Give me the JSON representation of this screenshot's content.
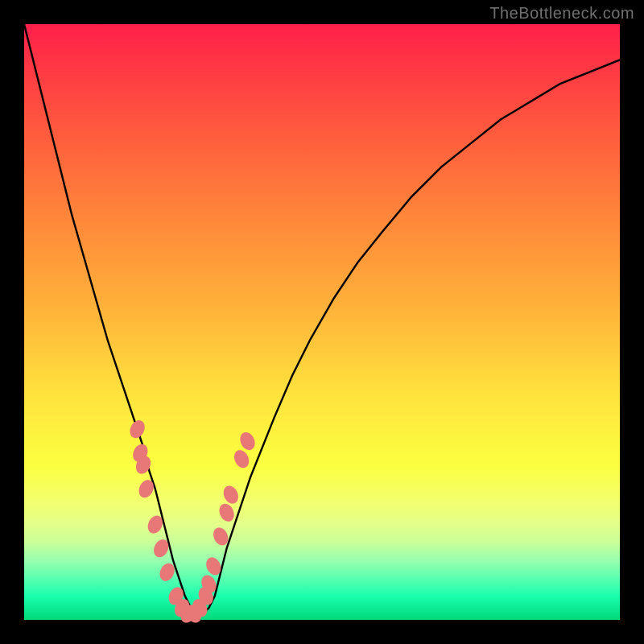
{
  "watermark": "TheBottleneck.com",
  "colors": {
    "background_frame": "#000000",
    "gradient_top": "#ff1f4a",
    "gradient_bottom": "#00d97b",
    "curve_stroke": "#000000",
    "marker_fill": "#e87878"
  },
  "chart_data": {
    "type": "line",
    "title": "",
    "xlabel": "",
    "ylabel": "",
    "xlim": [
      0,
      100
    ],
    "ylim": [
      0,
      100
    ],
    "grid": false,
    "legend": false,
    "series": [
      {
        "name": "bottleneck-curve",
        "x": [
          0,
          1,
          2,
          3,
          4,
          5,
          6,
          8,
          10,
          12,
          14,
          16,
          18,
          19,
          20,
          21,
          22,
          23,
          24,
          25,
          26,
          27,
          28,
          29,
          30,
          31,
          32,
          33,
          34,
          36,
          38,
          40,
          42,
          45,
          48,
          52,
          56,
          60,
          65,
          70,
          75,
          80,
          85,
          90,
          95,
          100
        ],
        "y": [
          100,
          96,
          92,
          88,
          84,
          80,
          76,
          68,
          61,
          54,
          47,
          41,
          35,
          32,
          29,
          25,
          22,
          18,
          14,
          10,
          7,
          4,
          2,
          1,
          1,
          2,
          4,
          8,
          12,
          18,
          24,
          29,
          34,
          41,
          47,
          54,
          60,
          65,
          71,
          76,
          80,
          84,
          87,
          90,
          92,
          94
        ]
      }
    ],
    "markers": {
      "name": "sample-points",
      "points": [
        {
          "x": 19.0,
          "y": 32
        },
        {
          "x": 19.5,
          "y": 28
        },
        {
          "x": 20.0,
          "y": 26
        },
        {
          "x": 20.5,
          "y": 22
        },
        {
          "x": 22.0,
          "y": 16
        },
        {
          "x": 23.0,
          "y": 12
        },
        {
          "x": 24.0,
          "y": 8
        },
        {
          "x": 25.5,
          "y": 4
        },
        {
          "x": 26.5,
          "y": 2
        },
        {
          "x": 27.5,
          "y": 1
        },
        {
          "x": 28.5,
          "y": 1
        },
        {
          "x": 29.5,
          "y": 2
        },
        {
          "x": 30.5,
          "y": 4
        },
        {
          "x": 31.0,
          "y": 6
        },
        {
          "x": 31.8,
          "y": 9
        },
        {
          "x": 33.0,
          "y": 14
        },
        {
          "x": 34.0,
          "y": 18
        },
        {
          "x": 34.7,
          "y": 21
        },
        {
          "x": 36.5,
          "y": 27
        },
        {
          "x": 37.5,
          "y": 30
        }
      ]
    }
  }
}
